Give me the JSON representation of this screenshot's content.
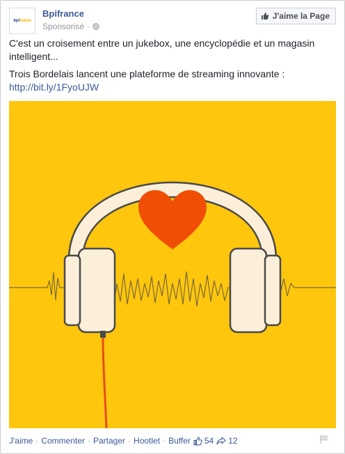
{
  "post": {
    "page_name": "Bpifrance",
    "sponsored": "Sponsorisé",
    "separator": "·",
    "like_page_label": "J'aime la Page",
    "avatar_logo": {
      "prefix": "bpi",
      "suffix": "france"
    },
    "text_line1": "C'est un croisement entre un jukebox, une encyclopédie et un magasin intelligent...",
    "text_line2": "Trois Bordelais lancent une plateforme de streaming innovante :",
    "link": "http://bit.ly/1FyoUJW"
  },
  "image": {
    "background": "#fec60d",
    "heart_color": "#f04e05",
    "headphone_color": "#fbefd9",
    "cable_color": "#e84d1b",
    "wave_color": "#7a6a3a"
  },
  "actions": {
    "like": "J'aime",
    "comment": "Commenter",
    "share": "Partager",
    "hootlet": "Hootlet",
    "buffer": "Buffer",
    "like_count": "54",
    "share_count": "12"
  },
  "icons": [
    "globe-icon",
    "thumbs-up-icon",
    "share-arrow-icon",
    "flag-icon"
  ]
}
